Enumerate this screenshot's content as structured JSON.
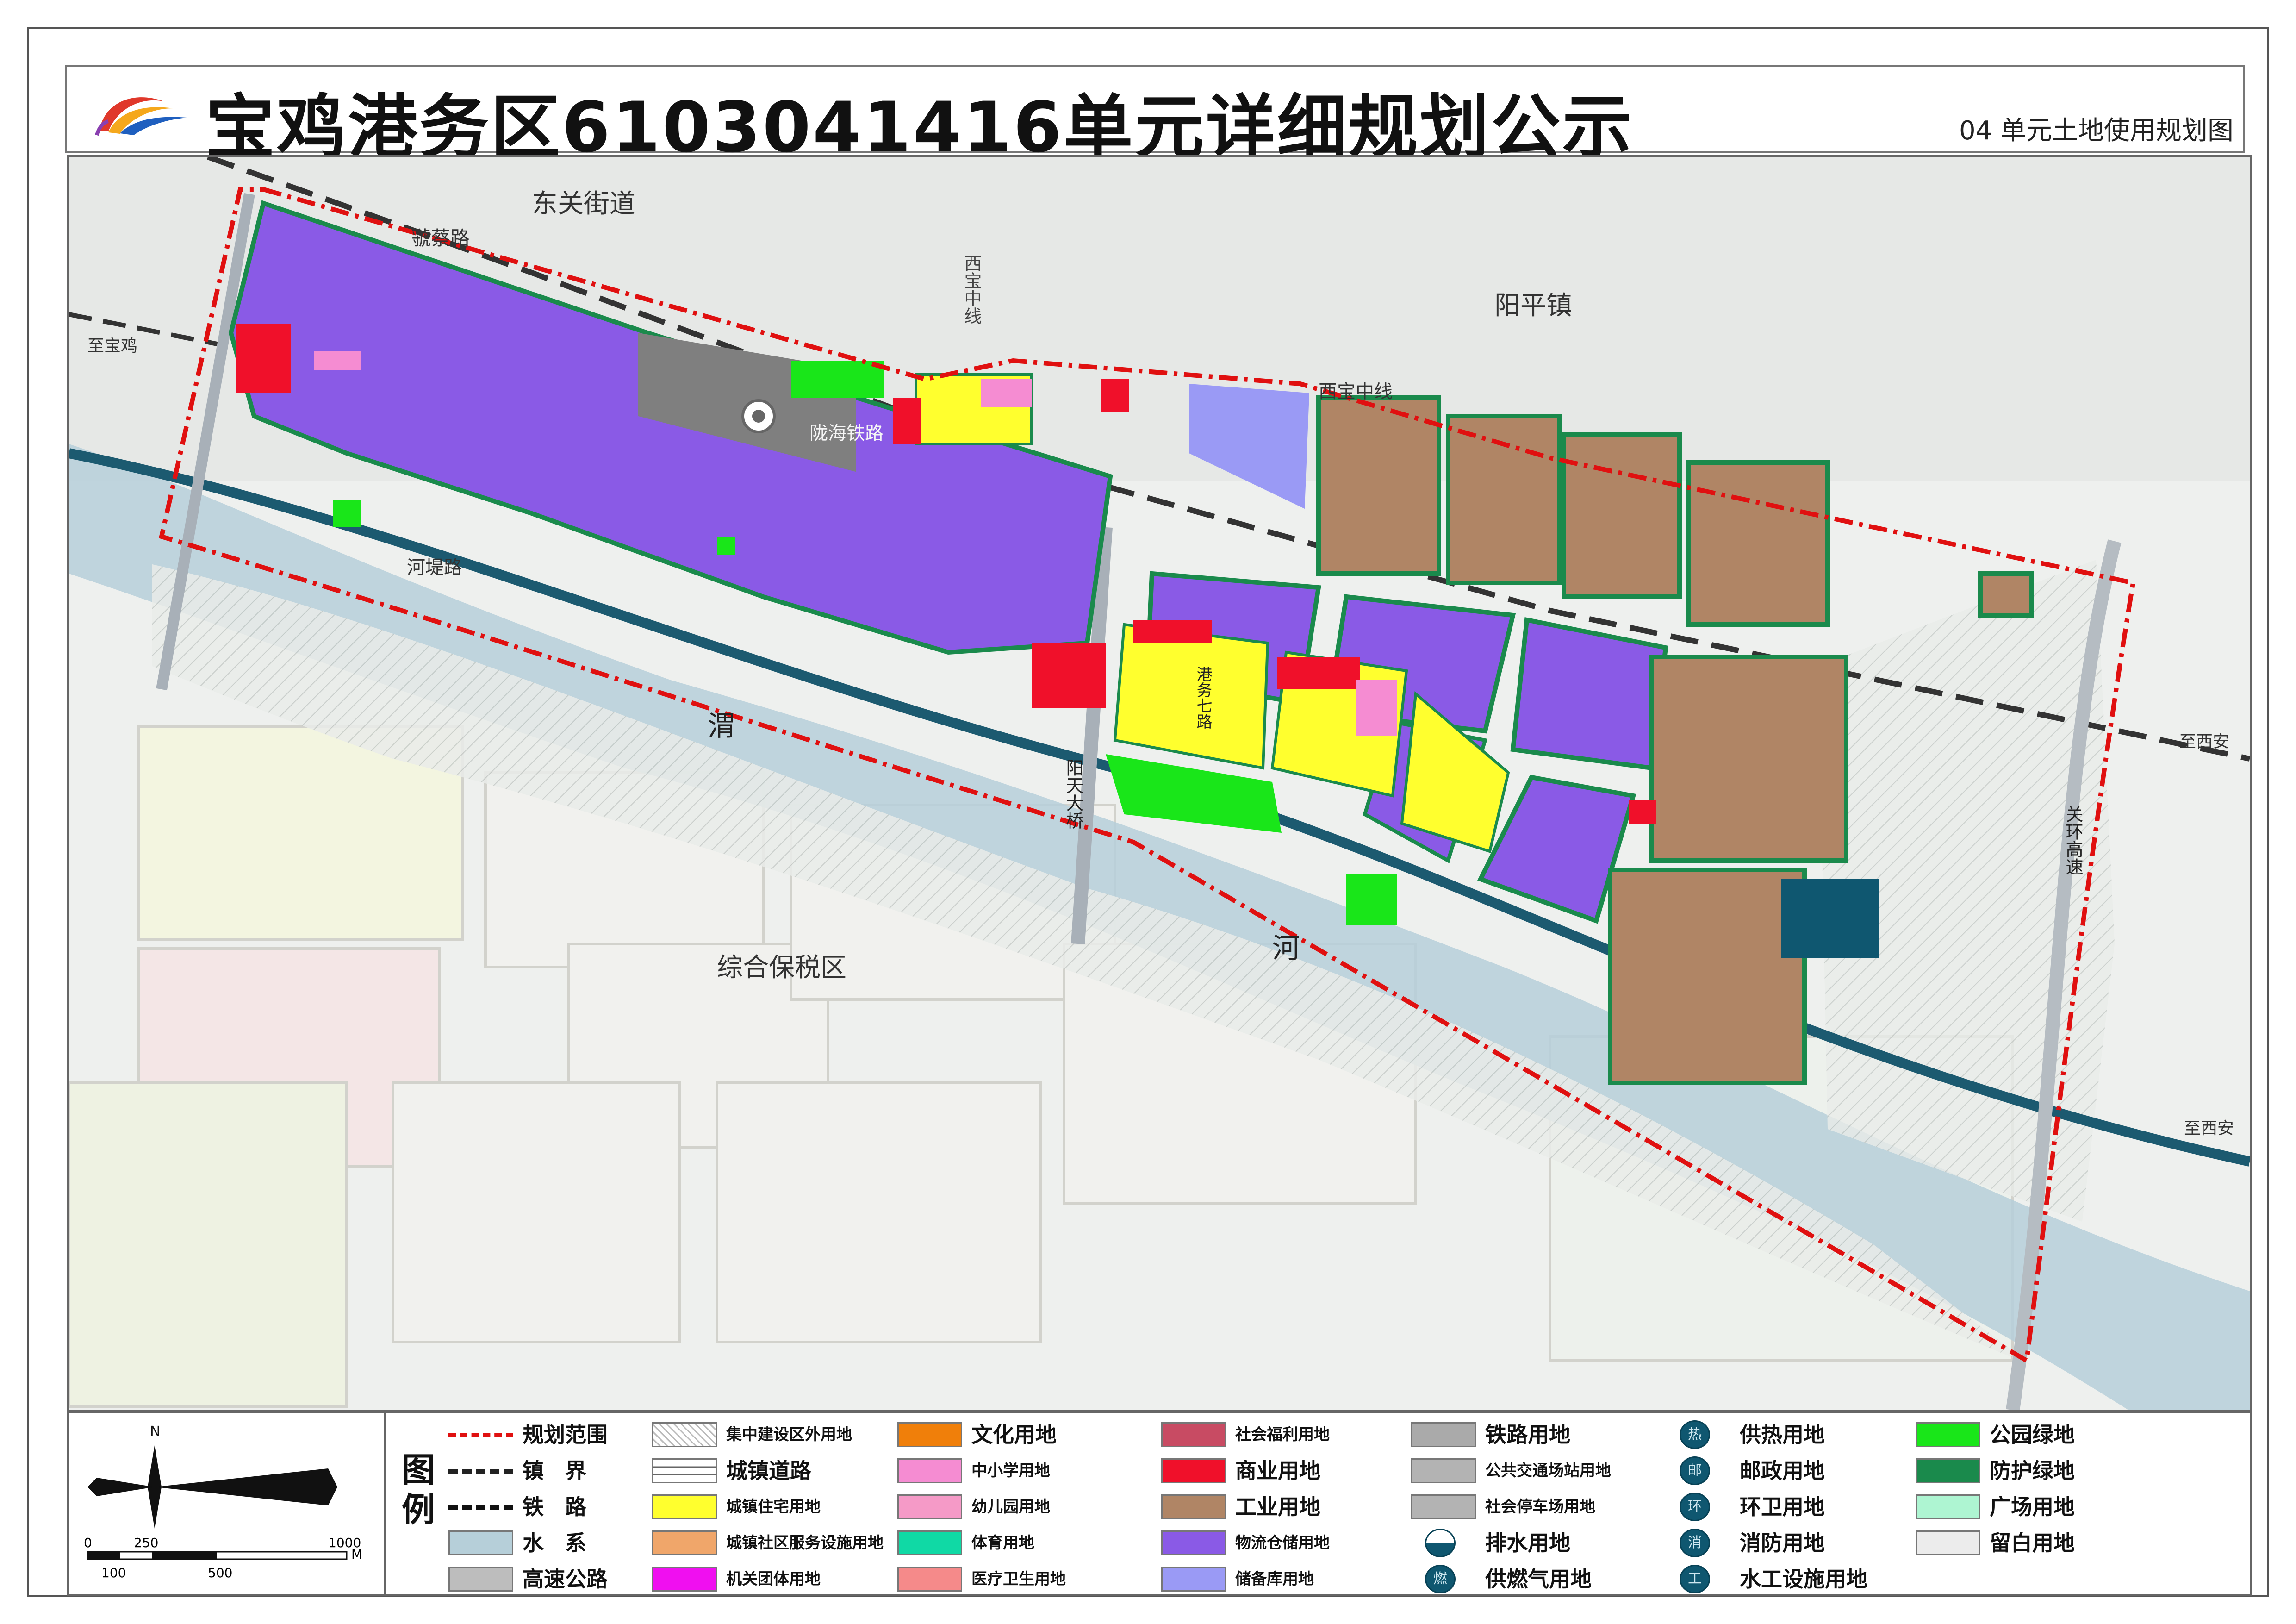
{
  "header": {
    "title": "宝鸡港务区6103041416单元详细规划公示",
    "subtitle": "04 单元土地使用规划图"
  },
  "map_labels": {
    "dongguan": "东关街道",
    "yangping": "阳平镇",
    "zonghe": "综合保税区",
    "road_guocai": "虢蔡路",
    "road_xibao_zhong": "西宝中线",
    "road_xibao_zhong_v": "西宝中线",
    "road_hedi": "河堤路",
    "road_yangtian": "阳天大桥",
    "road_zhibaoji": "至宝鸡",
    "road_zhixian1": "至西安",
    "road_zhixian2": "至西安",
    "road_guanhuan": "关环高速",
    "road_longhai": "陇海铁路",
    "road_tongxian": "港务七路",
    "river_wei": "渭",
    "river_he": "河",
    "station_icon": "railway-station-icon"
  },
  "legend": {
    "title": "图例",
    "items": [
      {
        "label": "规划范围",
        "key": "plan-boundary"
      },
      {
        "label": "镇　界",
        "key": "town-boundary"
      },
      {
        "label": "铁　路",
        "key": "railway"
      },
      {
        "label": "水　系",
        "key": "water"
      },
      {
        "label": "高速公路",
        "key": "expressway"
      },
      {
        "label": "集中建设区外用地",
        "key": "outside-land"
      },
      {
        "label": "城镇道路",
        "key": "town-road"
      },
      {
        "label": "城镇住宅用地",
        "key": "residential"
      },
      {
        "label": "城镇社区服务设施用地",
        "key": "community-service"
      },
      {
        "label": "机关团体用地",
        "key": "government"
      },
      {
        "label": "文化用地",
        "key": "culture"
      },
      {
        "label": "中小学用地",
        "key": "school"
      },
      {
        "label": "幼儿园用地",
        "key": "kindergarten"
      },
      {
        "label": "体育用地",
        "key": "sports"
      },
      {
        "label": "医疗卫生用地",
        "key": "medical"
      },
      {
        "label": "社会福利用地",
        "key": "welfare"
      },
      {
        "label": "商业用地",
        "key": "commercial"
      },
      {
        "label": "工业用地",
        "key": "industrial"
      },
      {
        "label": "物流仓储用地",
        "key": "logistics"
      },
      {
        "label": "储备库用地",
        "key": "reserve"
      },
      {
        "label": "铁路用地",
        "key": "railway-land"
      },
      {
        "label": "公共交通场站用地",
        "key": "transit-station"
      },
      {
        "label": "社会停车场用地",
        "key": "parking"
      },
      {
        "label": "排水用地",
        "key": "drainage"
      },
      {
        "label": "供燃气用地",
        "key": "gas"
      },
      {
        "label": "供热用地",
        "key": "heating"
      },
      {
        "label": "邮政用地",
        "key": "postal"
      },
      {
        "label": "环卫用地",
        "key": "sanitation"
      },
      {
        "label": "消防用地",
        "key": "fire"
      },
      {
        "label": "水工设施用地",
        "key": "hydraulic"
      },
      {
        "label": "公园绿地",
        "key": "park"
      },
      {
        "label": "防护绿地",
        "key": "protective-green"
      },
      {
        "label": "广场用地",
        "key": "plaza"
      },
      {
        "label": "留白用地",
        "key": "reserved-blank"
      }
    ],
    "icon_glyphs": {
      "heating": "热",
      "postal": "邮",
      "sanitation": "环",
      "fire": "消",
      "hydraulic": "工",
      "gas": "燃"
    }
  },
  "scale": {
    "north": "N",
    "ticks_top": [
      "0",
      "250",
      "1000"
    ],
    "ticks_bottom": [
      "100",
      "500"
    ],
    "unit": "M"
  },
  "colors": {
    "residential": "#ffff2e",
    "commercial": "#f0102a",
    "logistics": "#8a5ae6",
    "industrial": "#b08565",
    "park": "#19e619",
    "protective_green": "#1a8a4c",
    "school": "#f58cd2",
    "culture": "#f07f0a",
    "government": "#f00ff0",
    "sports": "#10d9a5",
    "medical": "#f58a8a",
    "welfare": "#c84b63",
    "reserve": "#9a9af5",
    "railway_land": "#aaaaaa",
    "utility": "#0f5770",
    "plaza": "#aef5d2",
    "blank": "#ececec",
    "boundary": "#e01010",
    "water": "#b6cfd9"
  }
}
